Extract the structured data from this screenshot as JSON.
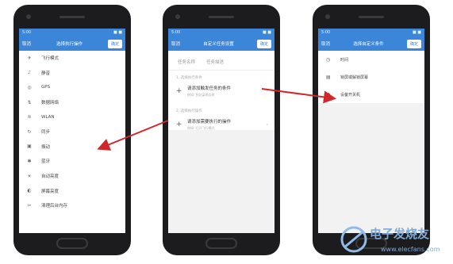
{
  "phone1": {
    "status_left": "5:00",
    "status_right": "■ ■",
    "back_label": "取消",
    "title": "选择执行操作",
    "confirm_label": "确定",
    "items": [
      {
        "icon": "airplane-icon",
        "glyph": "✈",
        "label": "飞行模式"
      },
      {
        "icon": "mute-icon",
        "glyph": "♪",
        "label": "静音"
      },
      {
        "icon": "gps-icon",
        "glyph": "◎",
        "label": "GPS"
      },
      {
        "icon": "mobile-data-icon",
        "glyph": "⇅",
        "label": "数据网络"
      },
      {
        "icon": "wifi-icon",
        "glyph": "≋",
        "label": "WLAN"
      },
      {
        "icon": "sync-icon",
        "glyph": "↻",
        "label": "同步"
      },
      {
        "icon": "vibrate-icon",
        "glyph": "▣",
        "label": "振动"
      },
      {
        "icon": "bluetooth-icon",
        "glyph": "✱",
        "label": "蓝牙"
      },
      {
        "icon": "auto-brightness-icon",
        "glyph": "☀",
        "label": "自动亮度"
      },
      {
        "icon": "brightness-icon",
        "glyph": "◐",
        "label": "屏幕亮度"
      },
      {
        "icon": "clean-memory-icon",
        "glyph": "✂",
        "label": "清理后台内存"
      }
    ]
  },
  "phone2": {
    "status_left": "5:00",
    "status_right": "■ ■",
    "back_label": "取消",
    "title": "自定义任务设置",
    "confirm_label": "确定",
    "tab_name": "任务名称",
    "tab_desc": "任务描述",
    "section_condition": "1. 选择执行条件",
    "add_condition_title": "请添加触发任务的条件",
    "add_condition_sub": "例如: 到达某地点时",
    "section_action": "2. 选择执行操作",
    "add_action_title": "请添加需要执行的操作",
    "add_action_sub": "例如: 打开飞行模式"
  },
  "phone3": {
    "status_left": "5:00",
    "status_right": "■ ■",
    "back_label": "取消",
    "title": "选择自定义条件",
    "confirm_label": "确定",
    "items": [
      {
        "icon": "clock-icon",
        "glyph": "◷",
        "label": "时间"
      },
      {
        "icon": "lock-icon",
        "glyph": "▤",
        "label": "锁屏或解锁屏幕"
      },
      {
        "icon": "power-icon",
        "glyph": "◑",
        "label": "设备开关机"
      }
    ]
  },
  "watermark": {
    "brand": "电子发烧友",
    "url": "www.elecfans.com"
  },
  "colors": {
    "accent": "#3b86d8",
    "arrow": "#d0282a"
  }
}
